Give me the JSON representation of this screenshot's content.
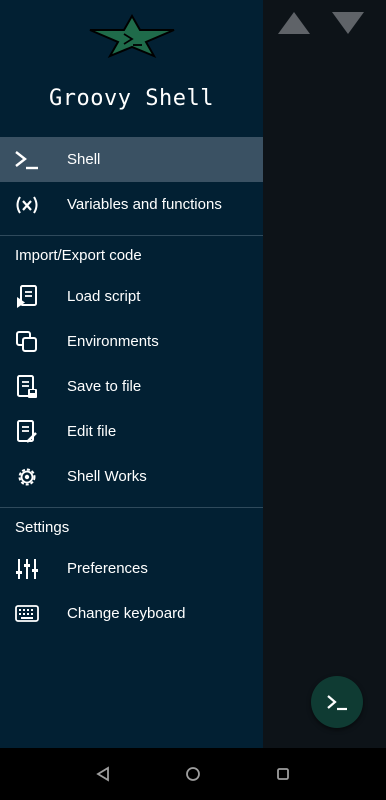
{
  "app": {
    "title": "Groovy Shell"
  },
  "menu": {
    "primary": [
      {
        "label": "Shell",
        "icon": "terminal-icon",
        "active": true
      },
      {
        "label": "Variables and functions",
        "icon": "variable-x-icon",
        "active": false
      }
    ],
    "import_export": {
      "header": "Import/Export code",
      "items": [
        {
          "label": "Load script",
          "icon": "load-script-icon"
        },
        {
          "label": "Environments",
          "icon": "environments-icon"
        },
        {
          "label": "Save to file",
          "icon": "save-file-icon"
        },
        {
          "label": "Edit file",
          "icon": "edit-file-icon"
        },
        {
          "label": "Shell Works",
          "icon": "gear-icon"
        }
      ]
    },
    "settings": {
      "header": "Settings",
      "items": [
        {
          "label": "Preferences",
          "icon": "sliders-icon"
        },
        {
          "label": "Change keyboard",
          "icon": "keyboard-icon"
        }
      ]
    }
  },
  "colors": {
    "drawer_bg": "#022033",
    "active_item_bg": "#3a5163",
    "fab_bg": "#0f3b33",
    "logo_green": "#1f6b4a"
  }
}
